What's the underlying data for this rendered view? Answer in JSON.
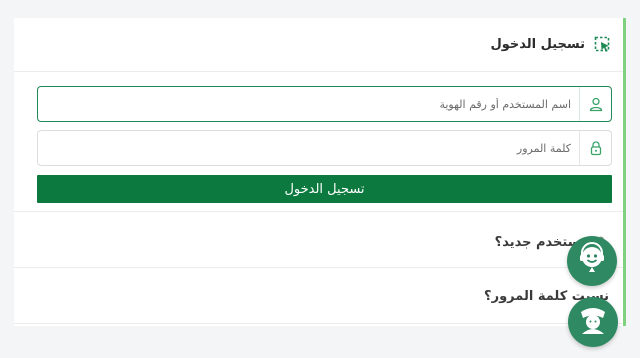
{
  "colors": {
    "accent_green": "#0c7a3f",
    "active_border": "#1f8a55",
    "card_edge": "#7fd17f",
    "fab_green": "#2f8a63"
  },
  "login": {
    "header_title": "تسجيل الدخول",
    "header_icon": "cursor-select-icon",
    "username": {
      "placeholder": "اسم المستخدم أو رقم الهوية",
      "value": "",
      "icon": "user-icon"
    },
    "password": {
      "placeholder": "كلمة المرور",
      "value": "",
      "icon": "lock-icon"
    },
    "submit_label": "تسجيل الدخول",
    "new_user_label": "مستخدم جديد؟",
    "forgot_password_label": "نسيت كلمة المرور؟"
  },
  "floating": {
    "chat_icon": "chat-support-icon",
    "assistant_icon": "assistant-avatar-icon"
  }
}
